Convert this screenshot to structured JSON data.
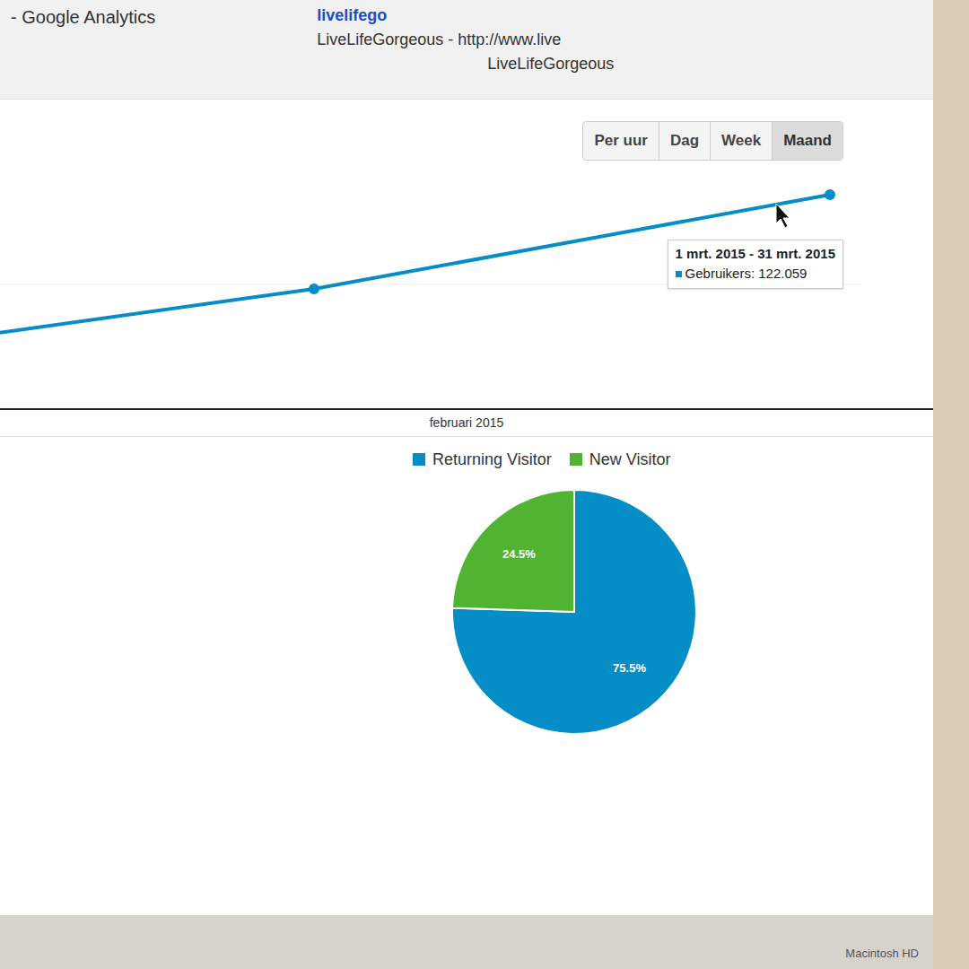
{
  "window": {
    "title": "- Google Analytics",
    "account": "livelifego",
    "property": "LiveLifeGorgeous - http://www.live",
    "view": "LiveLifeGorgeous"
  },
  "granularity": [
    {
      "label": "Per uur",
      "selected": false
    },
    {
      "label": "Dag",
      "selected": false
    },
    {
      "label": "Week",
      "selected": false
    },
    {
      "label": "Maand",
      "selected": true
    }
  ],
  "chart": {
    "series": [
      {
        "name": "Gebruikers",
        "values": [
          86700,
          102000,
          122059
        ],
        "color": "#058dc7"
      }
    ],
    "x_label": "februari 2015",
    "tooltip": {
      "range": "1 mrt. 2015 - 31 mrt. 2015",
      "metric": "Gebruikers: 122.059"
    }
  },
  "pie": {
    "slices": [
      {
        "label": "Returning Visitor",
        "share": 0.755,
        "reading": "75.5%",
        "color": "#058dc7"
      },
      {
        "label": "New Visitor",
        "share": 0.245,
        "reading": "24.5%",
        "color": "#50b432"
      }
    ]
  },
  "desktop": {
    "disk_label": "Macintosh HD"
  }
}
